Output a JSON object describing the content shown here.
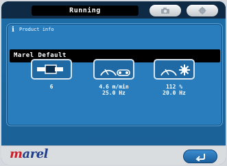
{
  "header": {
    "status_title": "Running"
  },
  "product_panel": {
    "title": "Product info",
    "product_name": "Marel Default"
  },
  "tiles": [
    {
      "icon": "conveyor-bundle-icon",
      "values": [
        "6"
      ]
    },
    {
      "icon": "belt-speed-gauge-icon",
      "values": [
        "4.6 m/min",
        "25.0 Hz"
      ]
    },
    {
      "icon": "fan-gauge-icon",
      "values": [
        "112 %",
        "20.0 Hz"
      ]
    }
  ],
  "footer": {
    "logo_text": "marel"
  },
  "colors": {
    "accent": "#1f6ea8",
    "logo_blue": "#1f3f8a",
    "logo_red": "#c8202a"
  }
}
